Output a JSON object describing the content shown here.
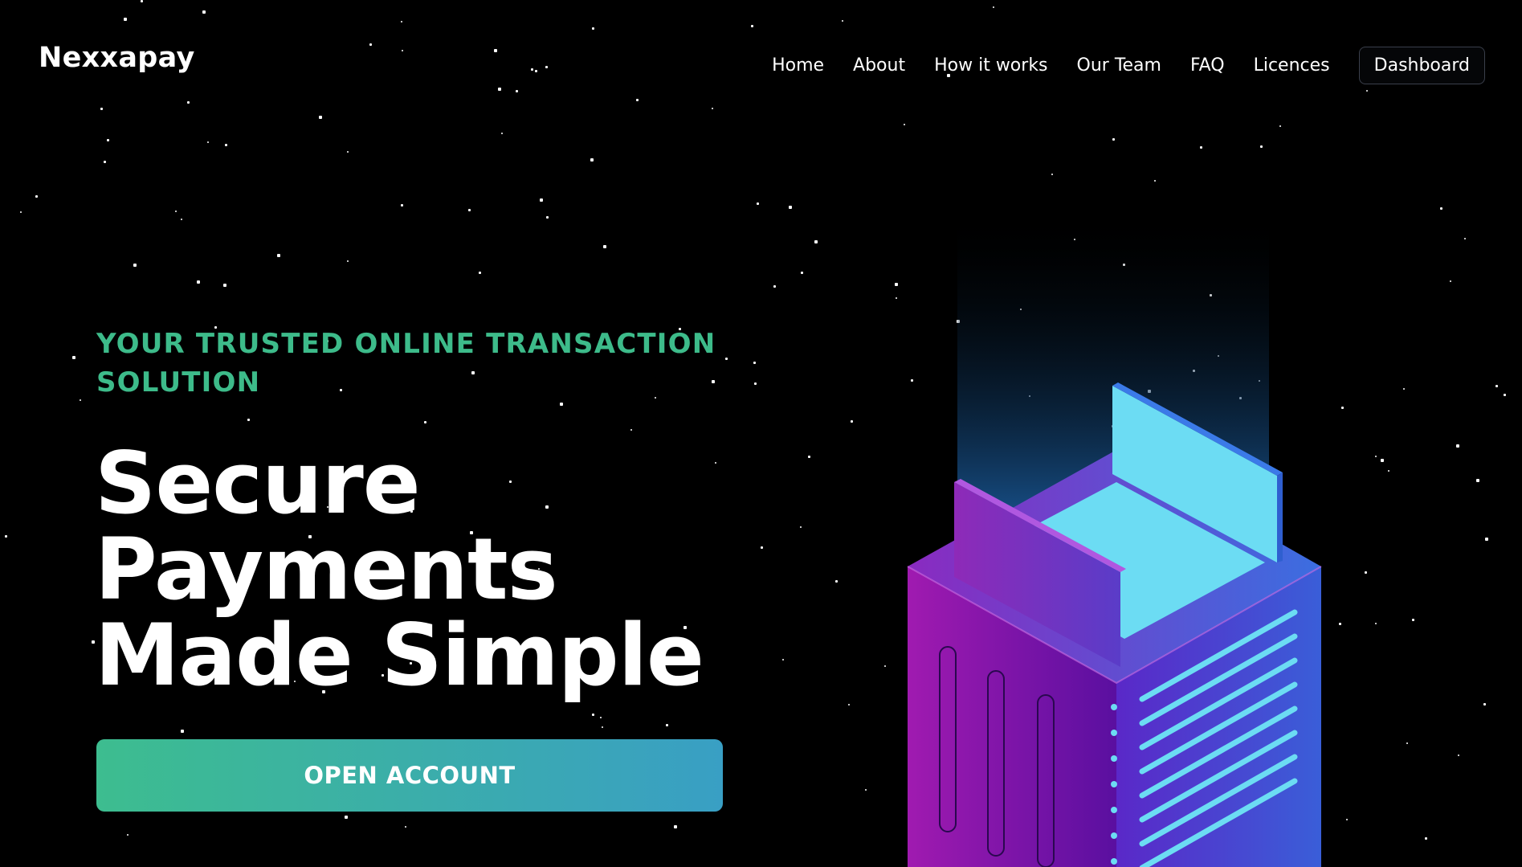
{
  "nav": {
    "brand": "Nexxapay",
    "links": [
      "Home",
      "About",
      "How it works",
      "Our Team",
      "FAQ",
      "Licences"
    ],
    "dashboard_label": "Dashboard"
  },
  "hero": {
    "tagline": "YOUR TRUSTED ONLINE TRANSACTION SOLUTION",
    "title_lines": [
      "Secure",
      "Payments",
      "Made Simple"
    ],
    "cta_label": "OPEN ACCOUNT"
  },
  "colors": {
    "background": "#000000",
    "accent_green": "#3dbb8a",
    "cta_gradient_start": "#3dbd8f",
    "cta_gradient_end": "#399fc4",
    "illustration_purple": "#7a1fb0",
    "illustration_cyan": "#6cdcf3",
    "illustration_blue": "#3b66e0"
  },
  "illustration": {
    "icon": "server-card-icon"
  }
}
